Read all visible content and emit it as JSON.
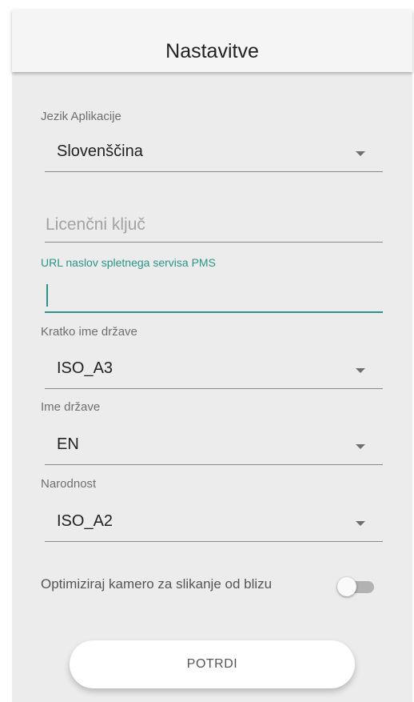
{
  "appbar": {
    "title": "Nastavitve"
  },
  "settings": {
    "language": {
      "label": "Jezik Aplikacije",
      "value": "Slovenščina"
    },
    "license": {
      "placeholder": "Licenčni ključ",
      "value": ""
    },
    "pms_url": {
      "label": "URL naslov spletnega servisa PMS",
      "value": ""
    },
    "country_short": {
      "label": "Kratko ime države",
      "value": "ISO_A3"
    },
    "country_name": {
      "label": "Ime države",
      "value": "EN"
    },
    "nationality": {
      "label": "Narodnost",
      "value": "ISO_A2"
    },
    "close_camera": {
      "label": "Optimiziraj kamero za slikanje od blizu",
      "enabled": false
    }
  },
  "actions": {
    "confirm_label": "POTRDI"
  },
  "colors": {
    "accent": "#2b9488",
    "appbar_bg": "#f5f5f5",
    "content_bg": "#ececec"
  },
  "icons": {
    "dropdown": "dropdown-caret-icon"
  }
}
